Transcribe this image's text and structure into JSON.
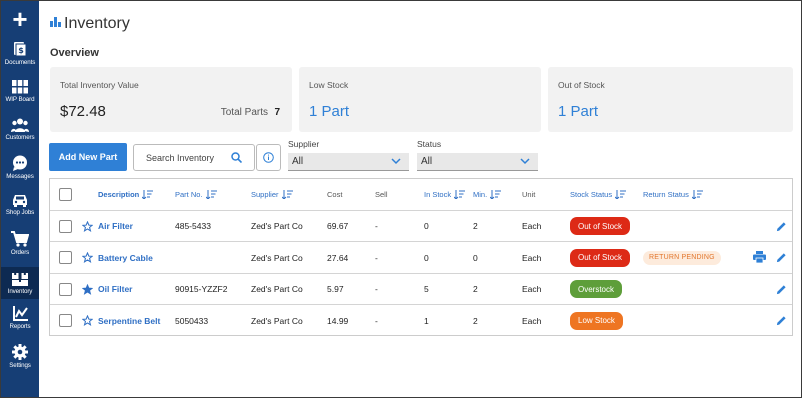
{
  "sidebar": {
    "add_icon": "plus-icon",
    "items": [
      {
        "label": "Documents",
        "icon": "document-dollar-icon"
      },
      {
        "label": "WIP Board",
        "icon": "grid-icon"
      },
      {
        "label": "Customers",
        "icon": "users-icon"
      },
      {
        "label": "Messages",
        "icon": "chat-icon"
      },
      {
        "label": "Shop Jobs",
        "icon": "car-icon"
      },
      {
        "label": "Orders",
        "icon": "cart-icon"
      },
      {
        "label": "Inventory",
        "icon": "boxes-icon",
        "active": true
      },
      {
        "label": "Reports",
        "icon": "chart-icon"
      },
      {
        "label": "Settings",
        "icon": "gear-icon"
      }
    ],
    "colors": {
      "background": "#163e75",
      "active": "#0d2a52"
    }
  },
  "header": {
    "title": "Inventory",
    "icon": "inventory-boxes-icon"
  },
  "overview": {
    "heading": "Overview",
    "cards": [
      {
        "title": "Total Inventory Value",
        "value": "$72.48",
        "extra_label": "Total Parts",
        "extra_value": "7"
      },
      {
        "title": "Low Stock",
        "value": "1 Part"
      },
      {
        "title": "Out of Stock",
        "value": "1 Part"
      }
    ]
  },
  "toolbar": {
    "add_button": "Add New Part",
    "search_placeholder": "Search Inventory",
    "supplier_label": "Supplier",
    "supplier_value": "All",
    "status_label": "Status",
    "status_value": "All"
  },
  "table": {
    "headers": {
      "description": "Description",
      "part_no": "Part No.",
      "supplier": "Supplier",
      "cost": "Cost",
      "sell": "Sell",
      "in_stock": "In Stock",
      "min": "Min.",
      "unit": "Unit",
      "stock_status": "Stock Status",
      "return_status": "Return Status"
    },
    "rows": [
      {
        "favorite": false,
        "description": "Air Filter",
        "part_no": "485-5433",
        "supplier": "Zed's Part Co",
        "cost": "69.67",
        "sell": "-",
        "in_stock": "0",
        "min": "2",
        "unit": "Each",
        "stock_status": "Out of Stock",
        "stock_color": "#dd2a16",
        "return_status": "",
        "printable": false
      },
      {
        "favorite": false,
        "description": "Battery Cable",
        "part_no": "",
        "supplier": "Zed's Part Co",
        "cost": "27.64",
        "sell": "-",
        "in_stock": "0",
        "min": "0",
        "unit": "Each",
        "stock_status": "Out of Stock",
        "stock_color": "#dd2a16",
        "return_status": "RETURN PENDING",
        "printable": true
      },
      {
        "favorite": true,
        "description": "Oil Filter",
        "part_no": "90915-YZZF2",
        "supplier": "Zed's Part Co",
        "cost": "5.97",
        "sell": "-",
        "in_stock": "5",
        "min": "2",
        "unit": "Each",
        "stock_status": "Overstock",
        "stock_color": "#5e9e3a",
        "return_status": "",
        "printable": false
      },
      {
        "favorite": false,
        "description": "Serpentine Belt",
        "part_no": "5050433",
        "supplier": "Zed's Part Co",
        "cost": "14.99",
        "sell": "-",
        "in_stock": "1",
        "min": "2",
        "unit": "Each",
        "stock_status": "Low Stock",
        "stock_color": "#ee7522",
        "return_status": "",
        "printable": false
      }
    ]
  },
  "colors": {
    "accent": "#2f80d6",
    "link": "#2f6fc4"
  }
}
